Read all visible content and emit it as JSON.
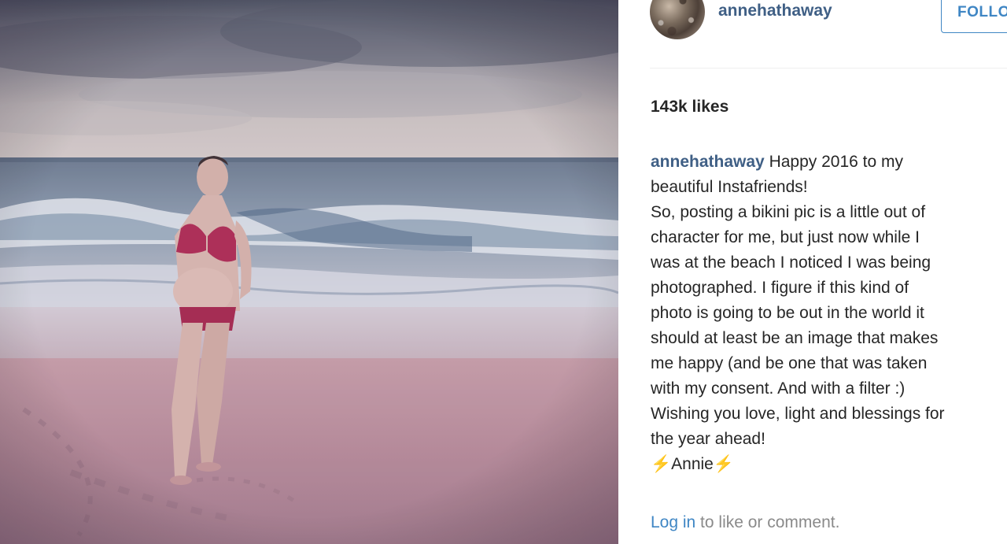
{
  "post": {
    "username": "annehathaway",
    "follow_label": "FOLLOW",
    "likes": "143k likes",
    "caption_author": "annehathaway",
    "caption_lines": [
      "Happy 2016 to my",
      "beautiful Instafriends!",
      "So, posting a bikini pic is a little out of",
      "character for me, but just now while I",
      "was at the beach I noticed I was being",
      "photographed. I figure if this kind of",
      "photo is going to be out in the world it",
      "should at least be an image that makes",
      "me happy (and be one that was taken",
      "with my consent. And with a filter :)",
      "Wishing you love, light and blessings for",
      "the year ahead!",
      "⚡️Annie⚡️"
    ],
    "login_link": "Log in",
    "login_suffix": " to like or comment."
  },
  "icons": {
    "avatar": "profile-avatar"
  }
}
